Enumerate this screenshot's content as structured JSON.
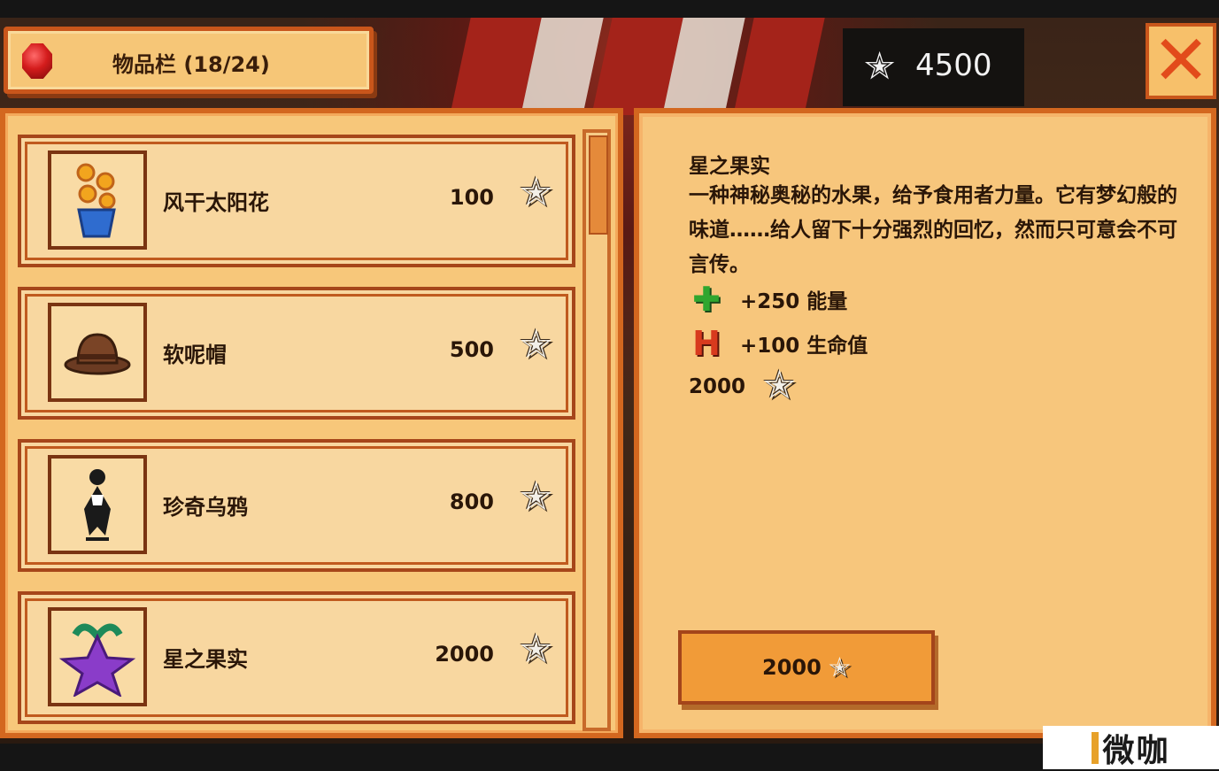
{
  "header": {
    "title": "物品栏 (18/24)",
    "money": "4500"
  },
  "items": [
    {
      "name": "风干太阳花",
      "price": "100",
      "icon": "dried-sunflower-icon"
    },
    {
      "name": "软呢帽",
      "price": "500",
      "icon": "fedora-hat-icon"
    },
    {
      "name": "珍奇乌鸦",
      "price": "800",
      "icon": "rare-crow-icon"
    },
    {
      "name": "星之果实",
      "price": "2000",
      "icon": "stardrop-icon"
    }
  ],
  "detail": {
    "name": "星之果实",
    "description": "一种神秘奥秘的水果，给予食用者力量。它有梦幻般的味道……给人留下十分强烈的回忆，然而只可意会不可言传。",
    "buffs": [
      {
        "text": "+250 能量",
        "icon": "energy-plus-icon"
      },
      {
        "text": "+100 生命值",
        "icon": "health-icon"
      }
    ],
    "price": "2000"
  },
  "buy_button": {
    "label": "2000"
  },
  "watermark": "微咖",
  "colors": {
    "panel": "#f7c77a",
    "border": "#d3671f",
    "close": "#e24b1b"
  }
}
